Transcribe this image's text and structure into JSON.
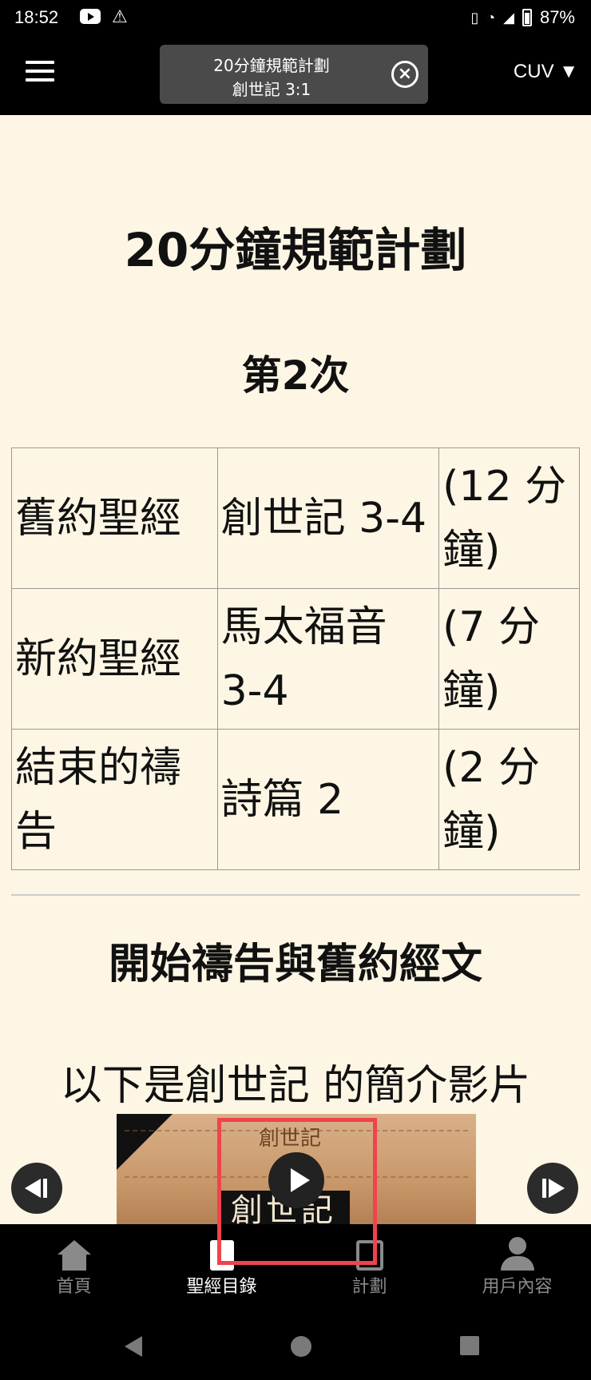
{
  "status_bar": {
    "time": "18:52",
    "battery": "87%"
  },
  "app_bar": {
    "plan_name": "20分鐘規範計劃",
    "reference": "創世記 3:1",
    "version": "CUV ▼"
  },
  "content": {
    "title": "20分鐘規範計劃",
    "session": "第2次",
    "plan_rows": [
      {
        "label": "舊約聖經",
        "reading": "創世記 3-4",
        "duration": "(12 分鐘)"
      },
      {
        "label": "新約聖經",
        "reading": "馬太福音 3-4",
        "duration": "(7 分鐘)"
      },
      {
        "label": "結束的禱告",
        "reading": "詩篇 2",
        "duration": "(2 分鐘)"
      }
    ],
    "section_title": "開始禱告與舊約經文",
    "intro_text": "以下是創世記 的簡介影片",
    "video": {
      "title_top": "創世記",
      "title_banner": "創世記"
    }
  },
  "bottom_nav": [
    {
      "label": "首頁",
      "icon": "home-icon"
    },
    {
      "label": "聖經目錄",
      "icon": "book-icon"
    },
    {
      "label": "計劃",
      "icon": "calendar-icon"
    },
    {
      "label": "用戶內容",
      "icon": "user-icon"
    }
  ]
}
